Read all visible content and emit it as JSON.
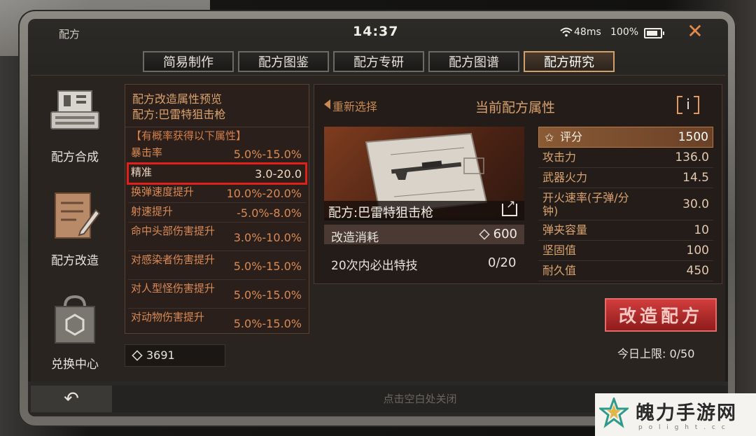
{
  "status": {
    "app_title": "配方",
    "time": "14:37",
    "ping": "48ms",
    "battery": "100%",
    "close_icon": "close-x-icon"
  },
  "tabs": [
    {
      "label": "简易制作",
      "active": false
    },
    {
      "label": "配方图鉴",
      "active": false
    },
    {
      "label": "配方专研",
      "active": false
    },
    {
      "label": "配方图谱",
      "active": false
    },
    {
      "label": "配方研究",
      "active": true
    }
  ],
  "sidebar": {
    "items": [
      {
        "label": "配方合成",
        "icon": "typewriter-icon"
      },
      {
        "label": "配方改造",
        "icon": "notepad-pen-icon"
      },
      {
        "label": "兑换中心",
        "icon": "shopping-bag-icon"
      }
    ]
  },
  "preview": {
    "title": "配方改造属性预览",
    "recipe": "配方:巴雷特狙击枪",
    "probability_note": "【有概率获得以下属性】",
    "attributes": [
      {
        "name": "暴击率",
        "range": "5.0%-15.0%"
      },
      {
        "name": "精准",
        "range": "3.0-20.0",
        "highlighted": true
      },
      {
        "name": "换弹速度提升",
        "range": "10.0%-20.0%"
      },
      {
        "name": "射速提升",
        "range": "-5.0%-8.0%"
      },
      {
        "name": "命中头部伤害提升",
        "range": "3.0%-10.0%"
      },
      {
        "name": "对感染者伤害提升",
        "range": "5.0%-15.0%"
      },
      {
        "name": "对人型怪伤害提升",
        "range": "5.0%-15.0%"
      },
      {
        "name": "对动物伤害提升",
        "range": "5.0%-15.0%"
      }
    ]
  },
  "currency": {
    "amount": "3691"
  },
  "current": {
    "reselect": "重新选择",
    "title": "当前配方属性",
    "info": "i",
    "recipe_name": "配方:巴雷特狙击枪",
    "cost_label": "改造消耗",
    "cost_value": "600",
    "guarantee_label": "20次内必出特技",
    "guarantee_value": "0/20"
  },
  "stats": [
    {
      "name": "评分",
      "value": "1500"
    },
    {
      "name": "攻击力",
      "value": "136.0"
    },
    {
      "name": "武器火力",
      "value": "14.5"
    },
    {
      "name": "开火速率(子弹/分钟)",
      "value": "30.0"
    },
    {
      "name": "弹夹容量",
      "value": "10"
    },
    {
      "name": "坚固值",
      "value": "100"
    },
    {
      "name": "耐久值",
      "value": "450"
    }
  ],
  "actions": {
    "modify_label": "改造配方",
    "daily_limit": "今日上限: 0/50"
  },
  "bottom": {
    "back_icon": "back-arrow-icon",
    "close_hint": "点击空白处关闭"
  },
  "watermark": {
    "title": "魄力手游网",
    "subtitle": "p o l i g h t . c c"
  }
}
